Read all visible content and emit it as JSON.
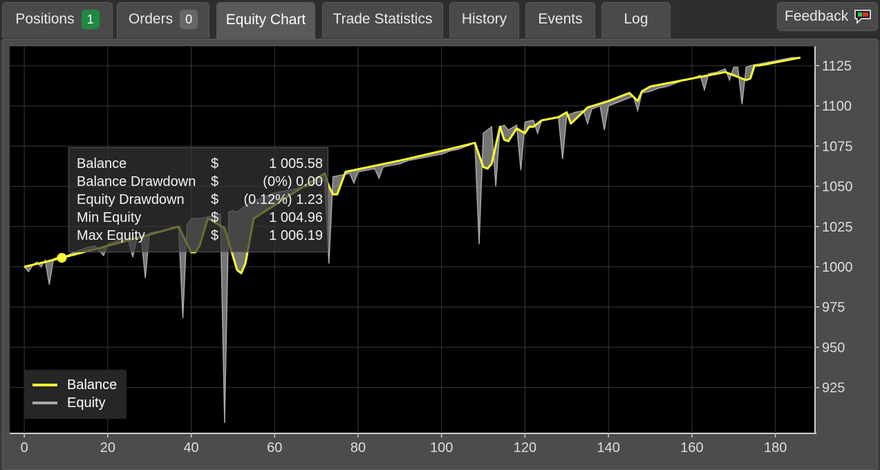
{
  "tabs": [
    {
      "label": "Positions",
      "badge": "1"
    },
    {
      "label": "Orders",
      "badge": "0"
    },
    {
      "label": "Equity Chart"
    },
    {
      "label": "Trade Statistics"
    },
    {
      "label": "History"
    },
    {
      "label": "Events"
    },
    {
      "label": "Log"
    }
  ],
  "feedback": {
    "label": "Feedback"
  },
  "colors": {
    "balance": "#ffff33",
    "equity": "#a8a8a8",
    "plot_bg": "#000000",
    "badge_positions": "#1e8a3f",
    "badge_orders": "#666666"
  },
  "tooltip": {
    "rows": [
      {
        "label": "Balance",
        "currency": "$",
        "value": "1 005.58"
      },
      {
        "label": "Balance Drawdown",
        "currency": "$",
        "value": "(0%)  0.00"
      },
      {
        "label": "Equity Drawdown",
        "currency": "$",
        "value": "(0.12%)  1.23"
      },
      {
        "label": "Min Equity",
        "currency": "$",
        "value": "1 004.96"
      },
      {
        "label": "Max Equity",
        "currency": "$",
        "value": "1 006.19"
      }
    ]
  },
  "legend": {
    "balance": "Balance",
    "equity": "Equity"
  },
  "chart_data": {
    "type": "line",
    "x_ticks": [
      0,
      20,
      40,
      60,
      80,
      100,
      120,
      140,
      160,
      180
    ],
    "y_ticks": [
      925,
      950,
      975,
      1000,
      1025,
      1050,
      1075,
      1100,
      1125
    ],
    "xlim": [
      -3.5,
      189.5
    ],
    "ylim": [
      896.5,
      1137
    ],
    "grid": true,
    "legend_position": "bottom-left",
    "highlight_point": {
      "x": 9,
      "y": 1005.58
    },
    "series": [
      {
        "name": "Balance",
        "x": [
          0,
          5,
          9,
          20,
          30,
          37,
          40,
          41,
          42,
          44,
          48,
          51,
          52,
          53,
          55,
          70,
          72,
          73,
          74,
          75,
          77,
          90,
          100,
          108,
          110,
          111,
          112,
          114,
          115,
          116,
          117,
          118,
          120,
          121,
          122,
          124,
          128,
          130,
          131,
          135,
          140,
          145,
          147,
          148,
          150,
          160,
          168,
          173,
          174,
          175,
          176,
          178,
          186
        ],
        "y": [
          1000,
          1003,
          1005.58,
          1013,
          1020,
          1025,
          1009,
          1009,
          1013,
          1030,
          1024,
          998,
          996,
          1002,
          1030,
          1055,
          1058,
          1050,
          1045,
          1045,
          1059,
          1066,
          1072,
          1077,
          1062,
          1061,
          1064,
          1087,
          1079,
          1078,
          1082,
          1086,
          1083,
          1087,
          1087,
          1091,
          1093,
          1096,
          1089,
          1099,
          1103,
          1108,
          1103,
          1109,
          1112,
          1117,
          1121,
          1116,
          1117,
          1125,
          1125,
          1126,
          1130
        ]
      },
      {
        "name": "Equity",
        "x": [
          0,
          1,
          2,
          3,
          4,
          5,
          6,
          7,
          8,
          9,
          11,
          13,
          15,
          17,
          18,
          19,
          20,
          22,
          24,
          25,
          26,
          27,
          28,
          29,
          30,
          32,
          34,
          36,
          37,
          38,
          39,
          40,
          42,
          44,
          46,
          47,
          48,
          49,
          50,
          51,
          52,
          53,
          54,
          56,
          58,
          60,
          62,
          64,
          66,
          68,
          70,
          72,
          73,
          74,
          76,
          78,
          79,
          80,
          82,
          84,
          85,
          86,
          88,
          90,
          92,
          94,
          96,
          98,
          100,
          102,
          104,
          106,
          108,
          109,
          110,
          112,
          113,
          114,
          115,
          116,
          118,
          119,
          120,
          122,
          123,
          124,
          126,
          128,
          129,
          130,
          132,
          134,
          135,
          136,
          138,
          139,
          140,
          142,
          144,
          146,
          147,
          148,
          150,
          152,
          154,
          156,
          158,
          160,
          162,
          163,
          164,
          166,
          168,
          169,
          170,
          171,
          172,
          173,
          174,
          176,
          178,
          180,
          182,
          184,
          186
        ],
        "y": [
          1000,
          997,
          1001,
          1003,
          1000,
          1004,
          989,
          1005,
          1006,
          1005.58,
          1008,
          1010,
          1012,
          1013,
          1010,
          1007,
          1014,
          1016,
          1017,
          1016,
          1006,
          1018,
          1019,
          993,
          1021,
          1022,
          1023,
          1025,
          1024,
          968,
          1026,
          1030,
          1030,
          1031,
          1032,
          1033,
          903,
          1034,
          1035,
          1034,
          1036,
          1038,
          1040,
          1042,
          1044,
          1046,
          1047,
          1048,
          1049,
          1050,
          1052,
          1054,
          1002,
          1056,
          1057,
          1058,
          1052,
          1059,
          1060,
          1061,
          1055,
          1062,
          1063,
          1064,
          1066,
          1067,
          1068,
          1069,
          1070,
          1072,
          1073,
          1075,
          1077,
          1014,
          1083,
          1087,
          1050,
          1087,
          1088,
          1085,
          1088,
          1060,
          1090,
          1091,
          1083,
          1091,
          1092,
          1093,
          1067,
          1094,
          1096,
          1097,
          1089,
          1098,
          1100,
          1085,
          1100,
          1102,
          1104,
          1106,
          1097,
          1108,
          1109,
          1111,
          1112,
          1114,
          1116,
          1117,
          1119,
          1110,
          1120,
          1121,
          1123,
          1116,
          1124,
          1124,
          1101,
          1124,
          1125,
          1126,
          1127,
          1128,
          1129,
          1130,
          1130
        ]
      }
    ]
  }
}
